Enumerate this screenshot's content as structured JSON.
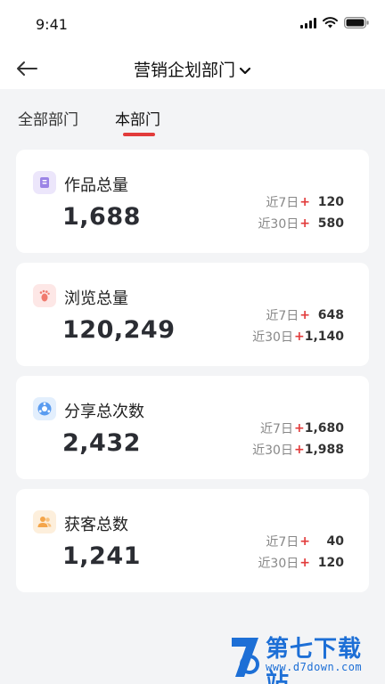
{
  "status": {
    "time": "9:41"
  },
  "nav": {
    "title": "营销企划部门"
  },
  "tabs": [
    {
      "label": "全部部门"
    },
    {
      "label": "本部门"
    }
  ],
  "cards": [
    {
      "label": "作品总量",
      "icon": "works-icon",
      "total": "1,688",
      "week_label": "近7日",
      "week_value": "120",
      "month_label": "近30日",
      "month_value": "580"
    },
    {
      "label": "浏览总量",
      "icon": "footprint-icon",
      "total": "120,249",
      "week_label": "近7日",
      "week_value": "648",
      "month_label": "近30日",
      "month_value": "1,140"
    },
    {
      "label": "分享总次数",
      "icon": "share-icon",
      "total": "2,432",
      "week_label": "近7日",
      "week_value": "1,680",
      "month_label": "近30日",
      "month_value": "1,988"
    },
    {
      "label": "获客总数",
      "icon": "customers-icon",
      "total": "1,241",
      "week_label": "近7日",
      "week_value": "40",
      "month_label": "近30日",
      "month_value": "120"
    }
  ],
  "plus_sign": "+",
  "watermark": {
    "name": "第七下载站",
    "url": "www.d7down.com"
  },
  "colors": {
    "accent": "#e23b3b",
    "background": "#f3f4f6",
    "watermark": "#1d6fd6"
  }
}
